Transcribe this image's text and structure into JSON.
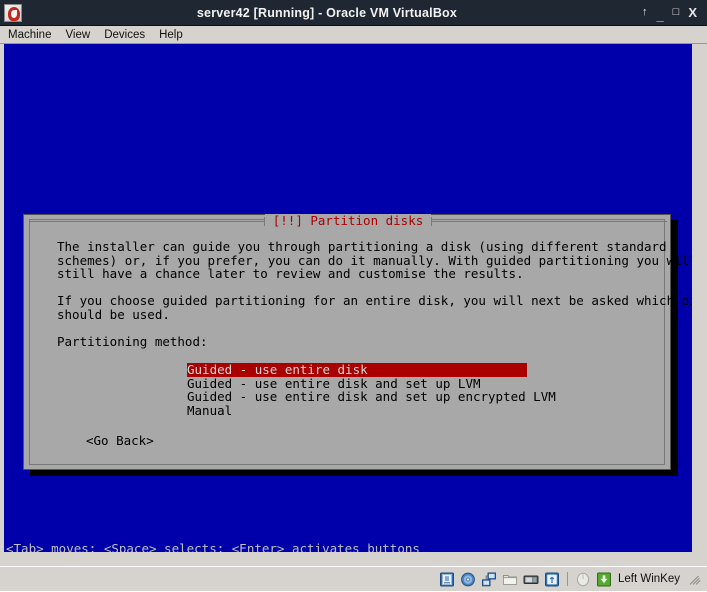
{
  "window": {
    "title": "server42 [Running] - Oracle VM VirtualBox",
    "icon": "virtualbox-icon",
    "controls": {
      "pin": "↑",
      "minimize": "_",
      "maximize": "□",
      "close": "X"
    }
  },
  "menubar": {
    "items": [
      {
        "label": "Machine"
      },
      {
        "label": "View"
      },
      {
        "label": "Devices"
      },
      {
        "label": "Help"
      }
    ]
  },
  "vm_console": {
    "background_color": "#0000aa",
    "dialog": {
      "title": "[!!] Partition disks",
      "title_color": "#aa0000",
      "background_color": "#a8a8a8",
      "paragraphs": [
        "The installer can guide you through partitioning a disk (using different standard\nschemes) or, if you prefer, you can do it manually. With guided partitioning you will\nstill have a chance later to review and customise the results.",
        "If you choose guided partitioning for an entire disk, you will next be asked which disk\nshould be used."
      ],
      "list_label": "Partitioning method:",
      "options": [
        {
          "label": "Guided - use entire disk",
          "selected": true
        },
        {
          "label": "Guided - use entire disk and set up LVM",
          "selected": false
        },
        {
          "label": "Guided - use entire disk and set up encrypted LVM",
          "selected": false
        },
        {
          "label": "Manual",
          "selected": false
        }
      ],
      "selection_color": "#aa0000",
      "buttons": [
        {
          "label": "<Go Back>"
        }
      ]
    },
    "statusline": "<Tab> moves; <Space> selects; <Enter> activates buttons"
  },
  "statusbar": {
    "icons": [
      {
        "name": "hard-disk-icon"
      },
      {
        "name": "optical-disk-icon"
      },
      {
        "name": "network-icon"
      },
      {
        "name": "shared-folder-icon"
      },
      {
        "name": "display-icon"
      },
      {
        "name": "usb-icon"
      },
      {
        "name": "mouse-integration-icon"
      },
      {
        "name": "host-key-icon"
      }
    ],
    "host_key_label": "Left WinKey"
  }
}
